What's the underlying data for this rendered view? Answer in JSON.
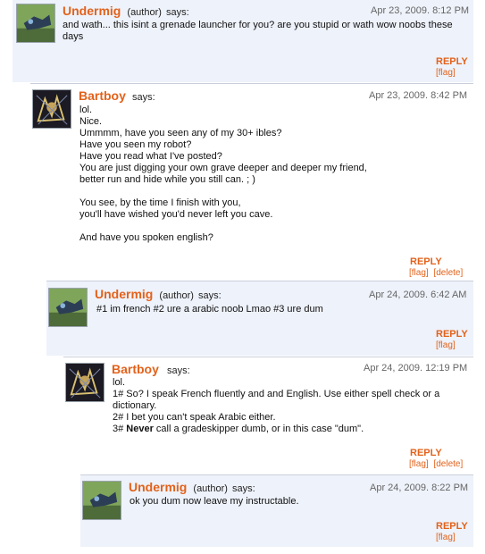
{
  "comments": [
    {
      "author": "Undermig",
      "author_tag": "(author)",
      "says": "says:",
      "date": "Apr 23, 2009. 8:12 PM",
      "lines": [
        "and wath... this isint a grenade launcher for you? are you stupid or wath wow noobs these",
        "days"
      ],
      "reply": "REPLY",
      "flag": "[flag]"
    },
    {
      "author": "Bartboy",
      "says": "says:",
      "date": "Apr 23, 2009. 8:42 PM",
      "lines": [
        "lol.",
        "Nice.",
        "Ummmm, have you seen any of my 30+ ibles?",
        "Have you seen my robot?",
        "Have you read what I've posted?",
        "You are just digging your own grave deeper and deeper my friend,",
        "better run and hide while you still can. ; )",
        "",
        "You see, by the time I finish with you,",
        "you'll have wished you'd never left you cave.",
        "",
        "And have you spoken english?"
      ],
      "reply": "REPLY",
      "flag": "[flag]",
      "delete": "[delete]"
    },
    {
      "author": "Undermig",
      "author_tag": "(author)",
      "says": "says:",
      "date": "Apr 24, 2009. 6:42 AM",
      "lines": [
        "#1 im french #2 ure a arabic noob Lmao #3 ure dum"
      ],
      "reply": "REPLY",
      "flag": "[flag]"
    },
    {
      "author": "Bartboy",
      "says": "says:",
      "date": "Apr 24, 2009. 12:19 PM",
      "lines": [
        "lol.",
        "1# So? I speak French fluently and and English. Use either spell check or a",
        "dictionary.",
        "2# I bet you can't speak Arabic either."
      ],
      "line_bold_prefix": "3# ",
      "line_bold": "Never",
      "line_bold_rest": " call a gradeskipper dumb, or in this case \"dum\".",
      "reply": "REPLY",
      "flag": "[flag]",
      "delete": "[delete]"
    },
    {
      "author": "Undermig",
      "author_tag": "(author)",
      "says": "says:",
      "date": "Apr 24, 2009. 8:22 PM",
      "lines": [
        "ok you dum now leave my instructable."
      ],
      "reply": "REPLY",
      "flag": "[flag]"
    }
  ]
}
